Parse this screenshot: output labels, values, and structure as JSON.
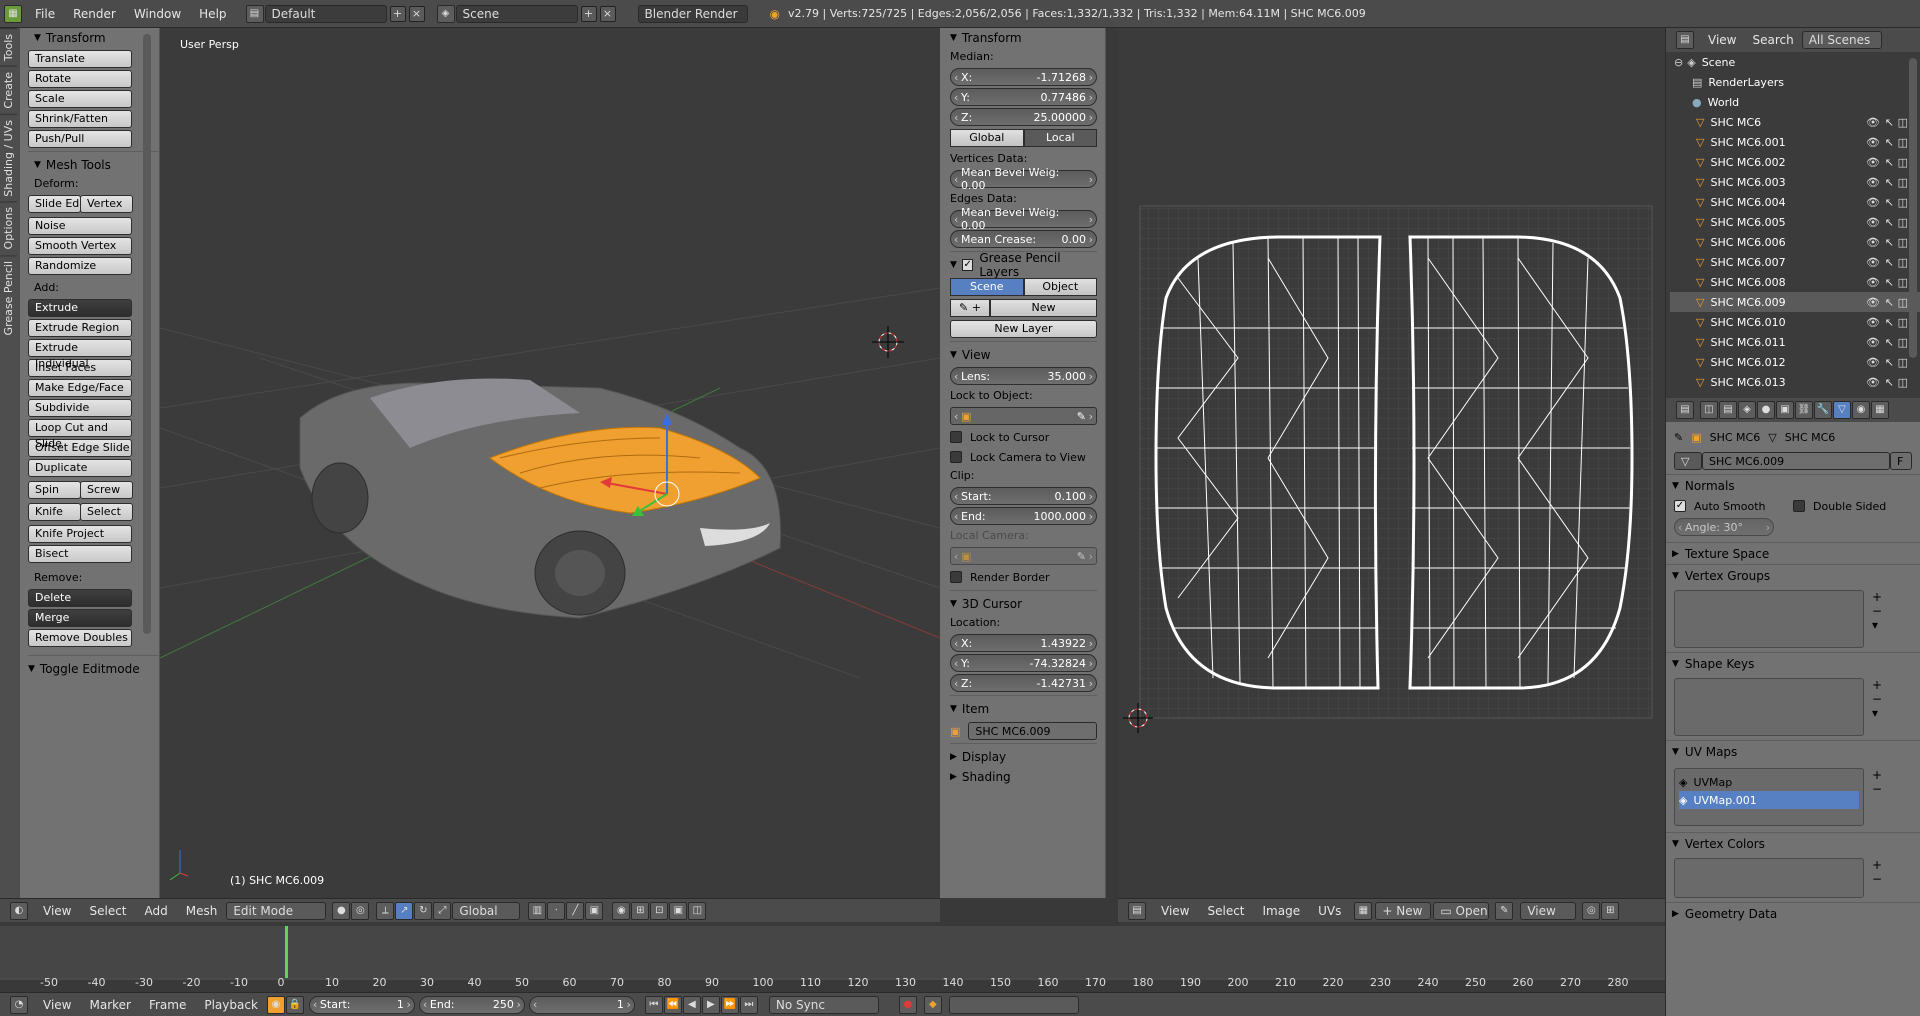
{
  "topbar": {
    "menus": [
      "File",
      "Render",
      "Window",
      "Help"
    ],
    "layout": "Default",
    "scene": "Scene",
    "engine": "Blender Render",
    "stats": "v2.79 | Verts:725/725 | Edges:2,056/2,056 | Faces:1,332/1,332 | Tris:1,332 | Mem:64.11M | SHC MC6.009"
  },
  "vtabs": [
    "Tools",
    "Create",
    "Shading / UVs",
    "Options",
    "Grease Pencil"
  ],
  "tools": {
    "transform_title": "Transform",
    "transform": [
      "Translate",
      "Rotate",
      "Scale",
      "Shrink/Fatten",
      "Push/Pull"
    ],
    "mesh_title": "Mesh Tools",
    "deform_label": "Deform:",
    "slide_edge": "Slide Ed",
    "vertex": "Vertex",
    "noise": "Noise",
    "smooth_vertex": "Smooth Vertex",
    "randomize": "Randomize",
    "add_label": "Add:",
    "extrude": "Extrude",
    "add_items": [
      "Extrude Region",
      "Extrude Individual",
      "Inset Faces",
      "Make Edge/Face",
      "Subdivide",
      "Loop Cut and Slide",
      "Offset Edge Slide",
      "Duplicate"
    ],
    "spin": "Spin",
    "screw": "Screw",
    "knife": "Knife",
    "select": "Select",
    "knife_project": "Knife Project",
    "bisect": "Bisect",
    "remove_label": "Remove:",
    "delete": "Delete",
    "merge": "Merge",
    "remove_doubles": "Remove Doubles",
    "toggle_editmode": "Toggle Editmode"
  },
  "viewport": {
    "label": "User Persp",
    "object_label": "(1) SHC MC6.009",
    "header_menus": [
      "View",
      "Select",
      "Add",
      "Mesh"
    ],
    "mode": "Edit Mode",
    "orientation": "Global"
  },
  "props": {
    "transform_title": "Transform",
    "median_label": "Median:",
    "x_label": "X:",
    "x_val": "-1.71268",
    "y_label": "Y:",
    "y_val": "0.77486",
    "z_label": "Z:",
    "z_val": "25.00000",
    "global": "Global",
    "local": "Local",
    "vertices_data": "Vertices Data:",
    "mean_bevel_v": "Mean Bevel Weig: 0.00",
    "edges_data": "Edges Data:",
    "mean_bevel_e": "Mean Bevel Weig: 0.00",
    "mean_crease_label": "Mean Crease:",
    "mean_crease_val": "0.00",
    "gp_title": "Grease Pencil Layers",
    "scene": "Scene",
    "object": "Object",
    "new": "New",
    "new_layer": "New Layer",
    "view_title": "View",
    "lens_label": "Lens:",
    "lens_val": "35.000",
    "lock_to_object": "Lock to Object:",
    "lock_to_cursor": "Lock to Cursor",
    "lock_camera": "Lock Camera to View",
    "clip_label": "Clip:",
    "start_label": "Start:",
    "start_val": "0.100",
    "end_label": "End:",
    "end_val": "1000.000",
    "local_camera": "Local Camera:",
    "render_border": "Render Border",
    "cursor_title": "3D Cursor",
    "location_label": "Location:",
    "cx_val": "1.43922",
    "cy_val": "-74.32824",
    "cz_val": "-1.42731",
    "item_title": "Item",
    "item_name": "SHC MC6.009",
    "display_title": "Display",
    "shading_title": "Shading"
  },
  "uv_header": {
    "menus": [
      "View",
      "Select",
      "Image",
      "UVs"
    ],
    "new": "New",
    "open": "Open",
    "view": "View"
  },
  "outliner": {
    "view": "View",
    "search": "Search",
    "filter": "All Scenes",
    "scene": "Scene",
    "renderlayers": "RenderLayers",
    "world": "World",
    "objects": [
      "SHC MC6",
      "SHC MC6.001",
      "SHC MC6.002",
      "SHC MC6.003",
      "SHC MC6.004",
      "SHC MC6.005",
      "SHC MC6.006",
      "SHC MC6.007",
      "SHC MC6.008",
      "SHC MC6.009",
      "SHC MC6.010",
      "SHC MC6.011",
      "SHC MC6.012",
      "SHC MC6.013"
    ]
  },
  "data_props": {
    "breadcrumb1": "SHC MC6",
    "breadcrumb2": "SHC MC6",
    "mesh_name": "SHC MC6.009",
    "fake_user": "F",
    "normals": "Normals",
    "auto_smooth": "Auto Smooth",
    "double_sided": "Double Sided",
    "angle": "Angle:   30°",
    "texture_space": "Texture Space",
    "vertex_groups": "Vertex Groups",
    "shape_keys": "Shape Keys",
    "uv_maps": "UV Maps",
    "uvmap1": "UVMap",
    "uvmap2": "UVMap.001",
    "vertex_colors": "Vertex Colors",
    "geometry_data": "Geometry Data"
  },
  "timeline": {
    "ticks": [
      "-50",
      "-40",
      "-30",
      "-20",
      "-10",
      "0",
      "10",
      "20",
      "30",
      "40",
      "50",
      "60",
      "70",
      "80",
      "90",
      "100",
      "110",
      "120",
      "130",
      "140",
      "150",
      "160",
      "170",
      "180",
      "190",
      "200",
      "210",
      "220",
      "230",
      "240",
      "250",
      "260",
      "270",
      "280"
    ],
    "menus": [
      "View",
      "Marker",
      "Frame",
      "Playback"
    ],
    "start": "Start:",
    "start_val": "1",
    "end": "End:",
    "end_val": "250",
    "current": "1",
    "sync": "No Sync"
  }
}
